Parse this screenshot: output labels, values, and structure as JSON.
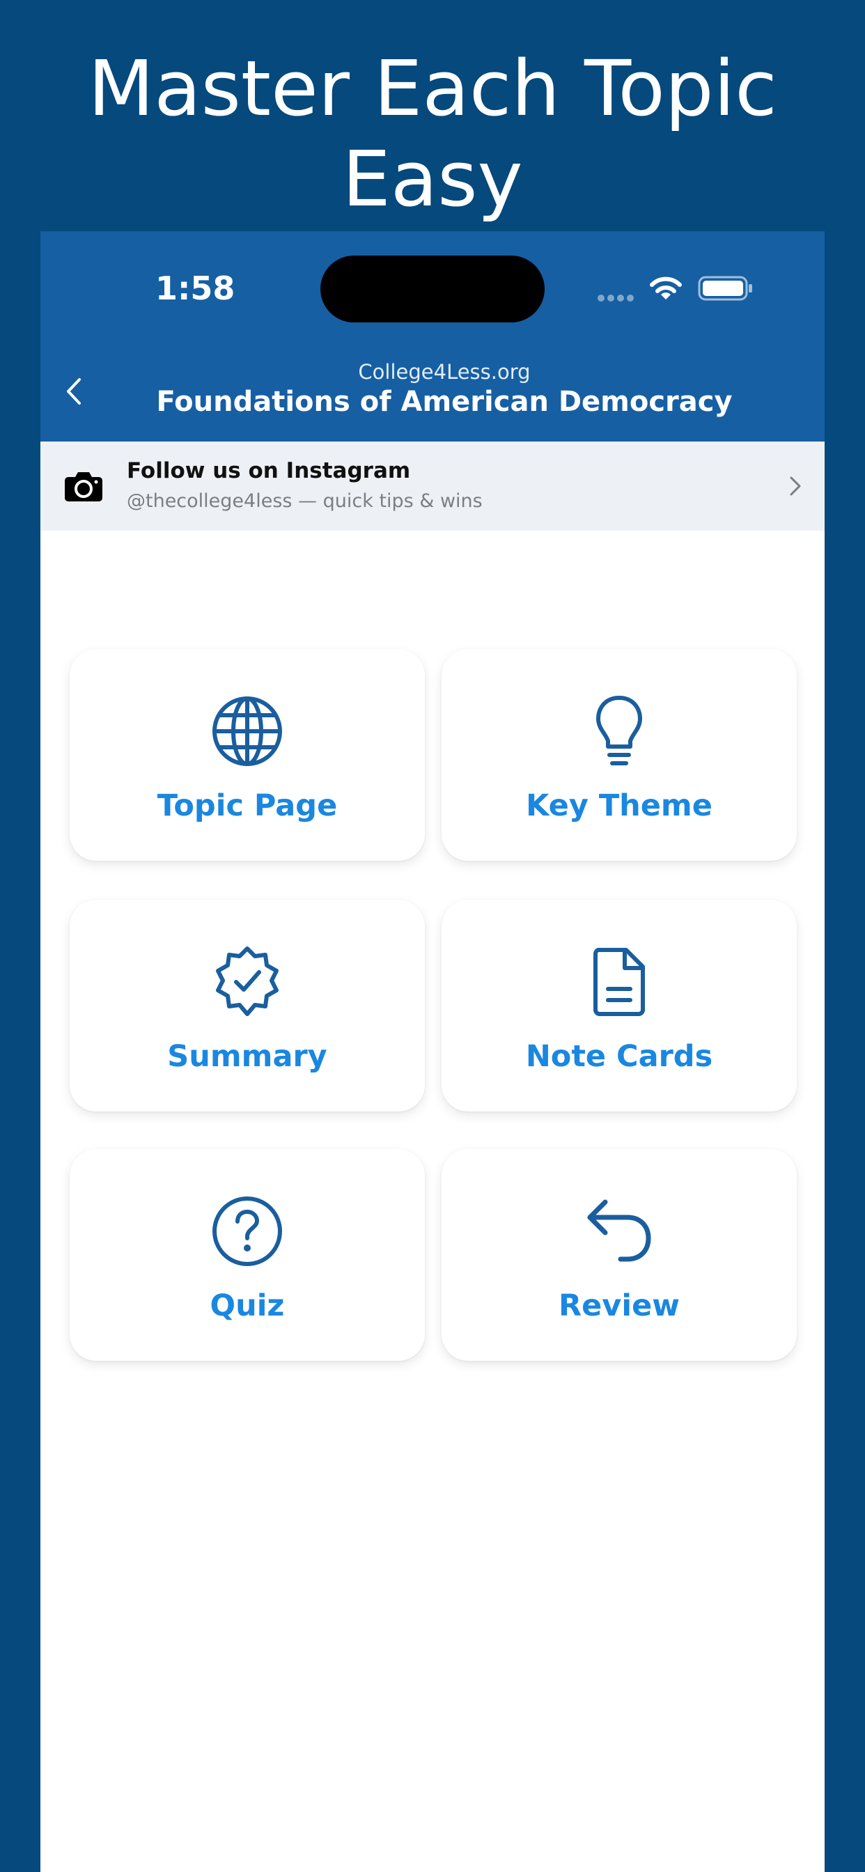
{
  "marketing": {
    "title": "Master Each Topic Easy"
  },
  "status_bar": {
    "time": "1:58"
  },
  "nav": {
    "subtitle": "College4Less.org",
    "title": "Foundations of American Democracy"
  },
  "instagram_banner": {
    "title": "Follow us on Instagram",
    "subtitle": "@thecollege4less — quick tips & wins"
  },
  "tiles": [
    {
      "label": "Topic Page",
      "icon": "globe-icon"
    },
    {
      "label": "Key Theme",
      "icon": "lightbulb-icon"
    },
    {
      "label": "Summary",
      "icon": "verified-badge-icon"
    },
    {
      "label": "Note Cards",
      "icon": "document-icon"
    },
    {
      "label": "Quiz",
      "icon": "question-circle-icon"
    },
    {
      "label": "Review",
      "icon": "return-arrow-icon"
    }
  ],
  "colors": {
    "background": "#05497d",
    "header": "#165fa3",
    "tile_icon": "#1a5e9e",
    "tile_label": "#1a87e0",
    "banner": "#edf1f5"
  }
}
